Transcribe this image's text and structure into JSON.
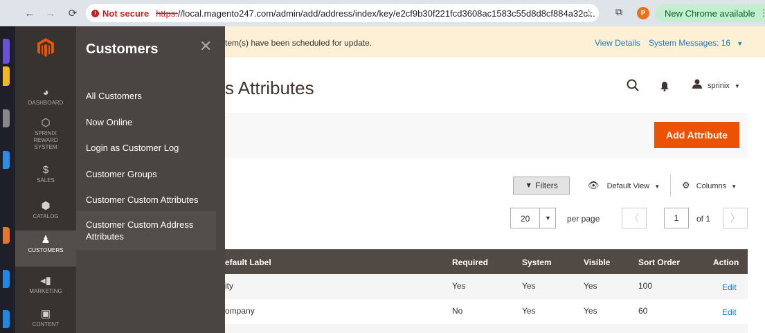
{
  "browser": {
    "security_label": "Not secure",
    "url_scheme": "https:",
    "url_rest": "//local.magento247.com/admin/add/address/index/key/e2cf9b30f221fcd3608ac1583c55d8d8cf884a32c...",
    "profile_initial": "P",
    "new_chrome_label": "New Chrome available"
  },
  "admin_nav": {
    "items": [
      {
        "label": "DASHBOARD",
        "icon": "dashboard-icon"
      },
      {
        "label": "SPRINIX REWARD SYSTEM",
        "icon": "hexagon-icon"
      },
      {
        "label": "SALES",
        "icon": "dollar-icon"
      },
      {
        "label": "CATALOG",
        "icon": "box-icon"
      },
      {
        "label": "CUSTOMERS",
        "icon": "person-icon"
      },
      {
        "label": "MARKETING",
        "icon": "megaphone-icon"
      },
      {
        "label": "CONTENT",
        "icon": "layout-icon"
      }
    ],
    "active": "CUSTOMERS"
  },
  "flyout": {
    "title": "Customers",
    "links": [
      "All Customers",
      "Now Online",
      "Login as Customer Log",
      "Customer Groups",
      "Customer Custom Attributes",
      "Customer Custom Address Attributes"
    ],
    "selected": "Customer Custom Address Attributes"
  },
  "header": {
    "message_text": "tem(s) have been scheduled for update.",
    "view_details": "View Details",
    "system_messages": "System Messages: 16",
    "page_title": "s Attributes",
    "user_name": "sprinix"
  },
  "actions": {
    "add_attribute": "Add Attribute"
  },
  "grid": {
    "filters_label": "Filters",
    "default_view_label": "Default View",
    "columns_label": "Columns",
    "per_page_value": "20",
    "per_page_label": "per page",
    "current_page": "1",
    "page_of": "of 1",
    "headers": [
      "efault Label",
      "Required",
      "System",
      "Visible",
      "Sort Order",
      "Action"
    ],
    "rows": [
      {
        "label": "ity",
        "required": "Yes",
        "system": "Yes",
        "visible": "Yes",
        "sort_order": "100",
        "action": "Edit"
      },
      {
        "label": "ompany",
        "required": "No",
        "system": "Yes",
        "visible": "Yes",
        "sort_order": "60",
        "action": "Edit"
      }
    ]
  },
  "colors": {
    "accent": "#eb5202",
    "nav_bg": "#373330",
    "flyout_bg": "#4a4542",
    "link": "#1979c3"
  }
}
